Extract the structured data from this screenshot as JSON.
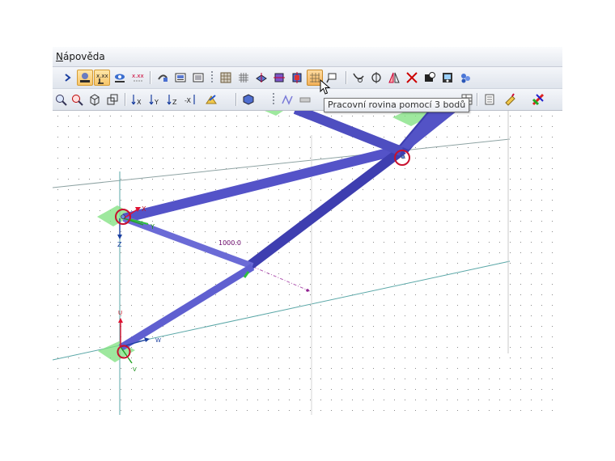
{
  "menu": {
    "help_first": "N",
    "help_rest": "ápověda"
  },
  "tooltip": "Pracovní rovina pomocí 3 bodů",
  "viewport": {
    "dimension_label": "1000.0",
    "axes": {
      "x": "X",
      "y": "Y",
      "z": "Z"
    },
    "local_axes": {
      "u": "U",
      "v": "V",
      "w": "W"
    }
  },
  "colors": {
    "member": "#5453c8",
    "member_dark": "#3a3aa8",
    "support": "#7ee07e",
    "selection_circle": "#c8102e",
    "grid_line": "#7fc6c6",
    "toolbar_active": "#f6c56a"
  },
  "toolbar1": {
    "icons": [
      "arrow-right-icon",
      "show-numbering-icon",
      "show-values-icon",
      "show-results-icon",
      "value-format-icon",
      "rotate-view-icon",
      "print-graphic-icon",
      "print-report-icon",
      "grid-dots-icon",
      "grid-snap-icon",
      "workplane-xy-icon",
      "workplane-xz-icon",
      "workplane-yz-icon",
      "workplane-3-points-icon",
      "object-snap-icon",
      "curve-icon",
      "circle-icon",
      "mirror-icon",
      "intersect-icon",
      "measure-icon",
      "view-settings-icon",
      "render-icon"
    ]
  },
  "toolbar2": {
    "icons": [
      "zoom-icon",
      "zoom-out-icon",
      "box-view-icon",
      "isometric-view-icon",
      "view-x-icon",
      "view-y-icon",
      "view-z-icon",
      "view-neg-x-icon",
      "display-options-icon",
      "render-solid-icon",
      "member-line-icon",
      "section-icon",
      "table-icon",
      "report-icon",
      "paint-icon",
      "color-scale-icon"
    ]
  }
}
